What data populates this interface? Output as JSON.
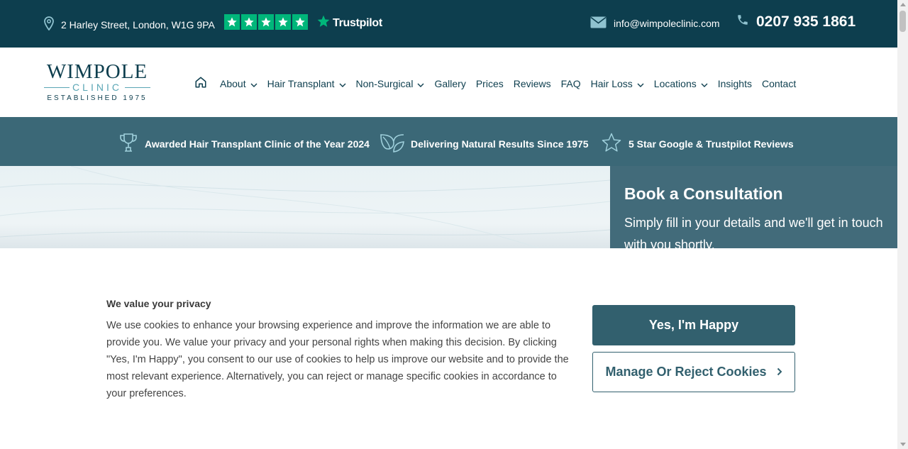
{
  "topbar": {
    "address": "2 Harley Street, London, W1G 9PA",
    "trustpilot_label": "Trustpilot",
    "trustpilot_rating_stars": 5,
    "email": "info@wimpoleclinic.com",
    "phone": "0207 935 1861"
  },
  "logo": {
    "line1": "WIMPOLE",
    "line2": "CLINIC",
    "line3": "ESTABLISHED 1975"
  },
  "nav": {
    "home_icon": "home-icon",
    "items": [
      {
        "label": "About",
        "dropdown": true
      },
      {
        "label": "Hair Transplant",
        "dropdown": true
      },
      {
        "label": "Non-Surgical",
        "dropdown": true
      },
      {
        "label": "Gallery",
        "dropdown": false
      },
      {
        "label": "Prices",
        "dropdown": false
      },
      {
        "label": "Reviews",
        "dropdown": false
      },
      {
        "label": "FAQ",
        "dropdown": false
      },
      {
        "label": "Hair Loss",
        "dropdown": true
      },
      {
        "label": "Locations",
        "dropdown": true
      },
      {
        "label": "Insights",
        "dropdown": false
      },
      {
        "label": "Contact",
        "dropdown": false
      }
    ]
  },
  "awards": [
    {
      "icon": "trophy-icon",
      "text": "Awarded Hair Transplant Clinic of the Year 2024"
    },
    {
      "icon": "leaf-icon",
      "text": "Delivering Natural Results Since 1975"
    },
    {
      "icon": "star-outline-icon",
      "text": "5 Star Google & Trustpilot Reviews"
    }
  ],
  "consultation": {
    "title": "Book a Consultation",
    "subtitle": "Simply fill in your details and we'll get in touch with you shortly."
  },
  "cookie": {
    "heading": "We value your privacy",
    "body": "We use cookies to enhance your browsing experience and improve the information we are able to provide you. We value your privacy and your personal rights when making this decision. By clicking \"Yes, I'm Happy\", you consent to our use of cookies to help us improve our website and to provide the most relevant experience. Alternatively, you can reject or manage specific cookies in accordance to your preferences.",
    "accept_label": "Yes, I'm Happy",
    "manage_label": "Manage Or Reject Cookies"
  },
  "colors": {
    "topbar": "#0d3e4e",
    "strip": "#3b6877",
    "accent": "#32606e",
    "trustpilot_green": "#00b67a"
  }
}
